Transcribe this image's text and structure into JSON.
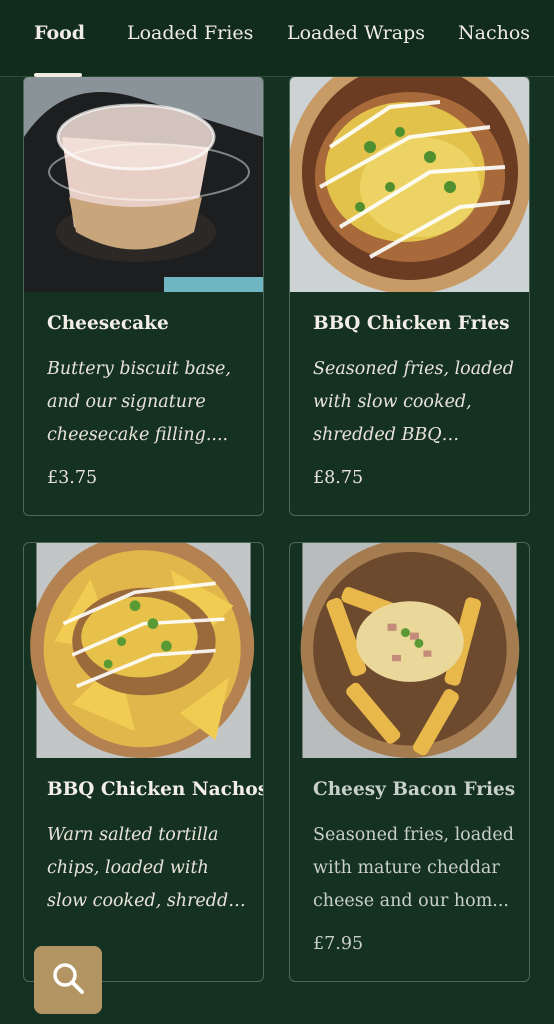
{
  "tabs": [
    {
      "label": "Food",
      "active": true
    },
    {
      "label": "Loaded Fries",
      "active": false
    },
    {
      "label": "Loaded Wraps",
      "active": false
    },
    {
      "label": "Nachos",
      "active": false
    }
  ],
  "menu_items": [
    {
      "name": "Cheesecake",
      "description": "Buttery biscuit base, and our signature cheesecake filling....",
      "price": "£3.75"
    },
    {
      "name": "BBQ Chicken Fries",
      "description": "Seasoned fries, loaded with slow cooked, shredded BBQ chicke...",
      "price": "£8.75"
    },
    {
      "name": "BBQ Chicken Nachos",
      "description": "Warn salted tortilla chips, loaded with slow cooked, shredded BB...",
      "price": ""
    },
    {
      "name": "Cheesy Bacon Fries",
      "description": "Seasoned fries, loaded with mature cheddar cheese and our hom...",
      "price": "£7.95"
    }
  ],
  "icons": {
    "search": "search-icon"
  },
  "colors": {
    "background": "#153121",
    "accent": "#b39463",
    "text": "#f3efe6"
  }
}
